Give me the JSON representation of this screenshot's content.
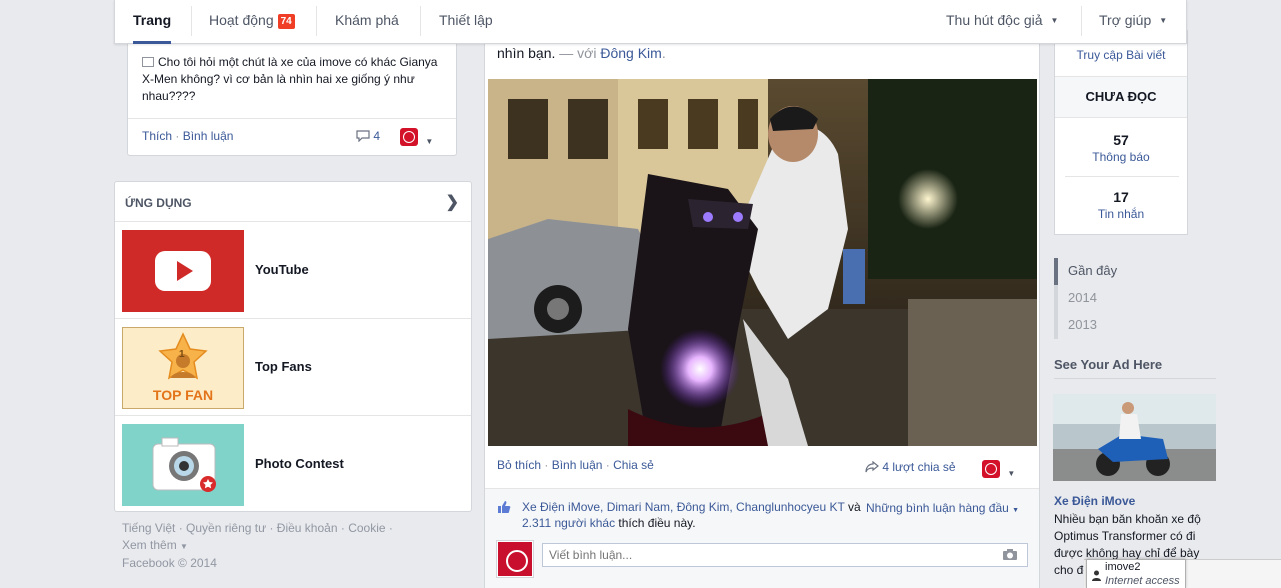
{
  "nav": {
    "tabs": [
      {
        "label": "Trang"
      },
      {
        "label": "Hoạt động",
        "badge": "74"
      },
      {
        "label": "Khám phá"
      },
      {
        "label": "Thiết lập"
      }
    ],
    "promote": "Thu hút độc giả",
    "help": "Trợ giúp"
  },
  "left_post": {
    "text": "Cho tôi hỏi một chút là xe của imove có khác Gianya X-Men không? vì cơ bản là nhìn hai xe giống ý như nhau????",
    "like": "Thích",
    "comment": "Bình luận",
    "comment_count": "4"
  },
  "apps": {
    "title": "ỨNG DỤNG",
    "items": [
      {
        "name": "YouTube"
      },
      {
        "name": "Top Fans",
        "thumb_text": "TOP FAN",
        "thumb_number": "1"
      },
      {
        "name": "Photo Contest"
      }
    ]
  },
  "footer": {
    "links": [
      "Tiếng Việt",
      "Quyền riêng tư",
      "Điều khoản",
      "Cookie"
    ],
    "more": "Xem thêm",
    "copyright": "Facebook © 2014"
  },
  "feed_post": {
    "text_end": "nhìn bạn.",
    "with_prefix": "— với",
    "tagged": "Đông Kim",
    "unlike": "Bỏ thích",
    "comment": "Bình luận",
    "share": "Chia sẻ",
    "share_count": "4 lượt chia sẻ",
    "likers": "Xe Điện iMove, Dimari Nam, Đông Kim, Changlunhocyeu KT",
    "likes_and": "và",
    "others": "2.311 người khác",
    "likes_suffix": "thích điều này.",
    "top_comments": "Những bình luận hàng đầu",
    "comment_placeholder": "Viết bình luận..."
  },
  "right": {
    "visit_posts": "Truy cập Bài viết",
    "unread_title": "CHƯA ĐỌC",
    "notifications": {
      "count": "57",
      "label": "Thông báo"
    },
    "messages": {
      "count": "17",
      "label": "Tin nhắn"
    },
    "years": [
      "Gần đây",
      "2014",
      "2013"
    ],
    "ad_heading": "See Your Ad Here",
    "ad_title": "Xe Điện iMove",
    "ad_text": "Nhiều bạn băn khoăn xe độ Optimus Transformer có đi được không hay chỉ để bày cho đẹp"
  },
  "chat": {
    "name": "imove2",
    "status": "Internet access"
  },
  "colors": {
    "brand": "#3b5998",
    "badge": "#f03d25",
    "imove_red": "#d3122a"
  }
}
